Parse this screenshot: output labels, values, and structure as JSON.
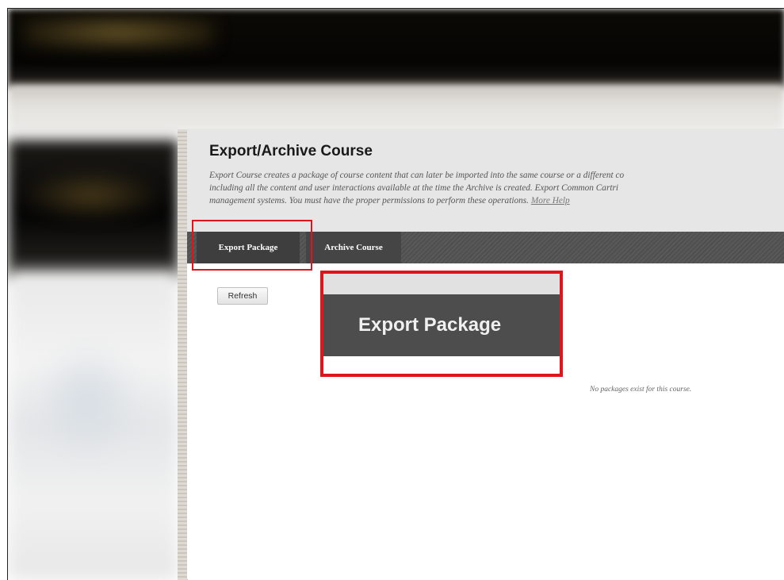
{
  "page": {
    "title": "Export/Archive Course",
    "description_lines": [
      "Export Course creates a package of course content that can later be imported into the same course or a different co",
      "including all the content and user interactions available at the time the Archive is created. Export Common Cartri",
      "management systems. You must have the proper permissions to perform these operations."
    ],
    "more_help": "More Help"
  },
  "tabs": [
    {
      "label": "Export Package",
      "active": true
    },
    {
      "label": "Archive Course",
      "active": false
    }
  ],
  "toolbar": {
    "refresh_label": "Refresh"
  },
  "empty_message": "No packages exist for this course.",
  "callout": {
    "label": "Export Package"
  },
  "colors": {
    "highlight": "#e0141b",
    "tab_bar": "#555555",
    "header_bg": "#e6e6e6"
  }
}
